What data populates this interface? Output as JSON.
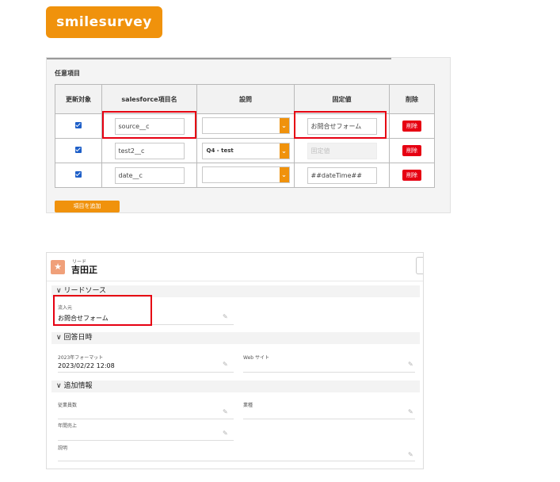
{
  "logo": {
    "text": "smilesurvey"
  },
  "mapping": {
    "section_title": "任意項目",
    "headers": [
      "更新対象",
      "salesforce項目名",
      "設問",
      "固定値",
      "削除"
    ],
    "rows": [
      {
        "checked": true,
        "field": "source__c",
        "question": "",
        "fixed_value": "お問合せフォーム",
        "fixed_disabled": false,
        "delete": "削除"
      },
      {
        "checked": true,
        "field": "test2__c",
        "question": "Q4 - test",
        "fixed_value": "固定値",
        "fixed_disabled": true,
        "delete": "削除"
      },
      {
        "checked": true,
        "field": "date__c",
        "question": "",
        "fixed_value": "##dateTime##",
        "fixed_disabled": false,
        "delete": "削除"
      }
    ],
    "add_button": "項目を追加",
    "highlight_color": "#e60012",
    "accent_color": "#f0920c"
  },
  "lead": {
    "object_label": "リード",
    "record_name": "吉田正",
    "sections": {
      "lead_source": {
        "title": "リードソース",
        "source_label": "流入元",
        "source_value": "お問合せフォーム"
      },
      "answer_datetime": {
        "title": "回答日時",
        "format_label": "2023年フォーマット",
        "format_value": "2023/02/22 12:08",
        "website_label": "Web サイト",
        "website_value": ""
      },
      "additional": {
        "title": "追加情報",
        "employees_label": "従業員数",
        "industry_label": "業種",
        "revenue_label": "年間売上",
        "description_label": "説明"
      }
    }
  }
}
